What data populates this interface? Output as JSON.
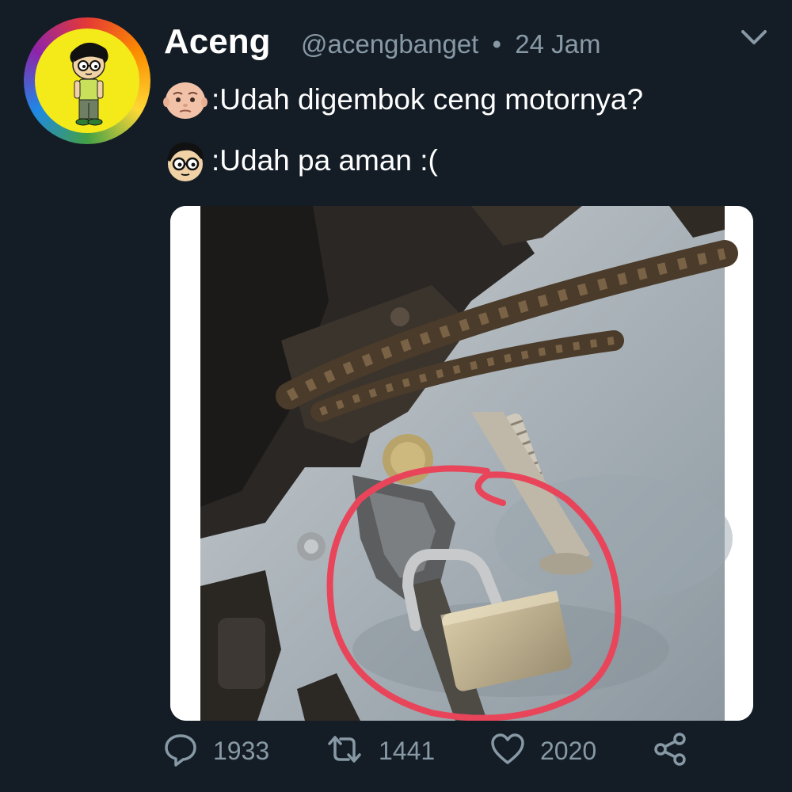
{
  "tweet": {
    "display_name": "Aceng",
    "handle": "@acengbanget",
    "separator": "•",
    "time": "24 Jam",
    "lines": [
      {
        "emoji": "baby-face-emoji",
        "text": ":Udah digembok ceng motornya?"
      },
      {
        "emoji": "glasses-boy-emoji",
        "text": ":Udah pa aman :("
      }
    ],
    "stats": {
      "replies": "1933",
      "retweets": "1441",
      "likes": "2020"
    }
  },
  "icons": {
    "reply": "reply-icon",
    "retweet": "retweet-icon",
    "like": "heart-icon",
    "share": "share-icon",
    "menu": "chevron-down-icon"
  },
  "colors": {
    "background": "#141d26",
    "muted": "#8899a6",
    "circle_annotation": "#e8455a"
  }
}
